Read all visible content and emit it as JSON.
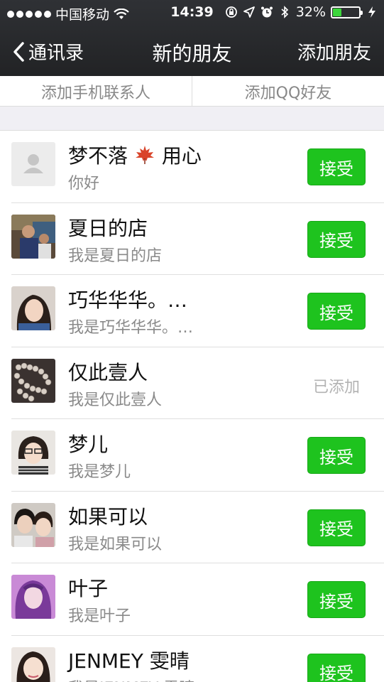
{
  "status": {
    "carrier": "中国移动",
    "time": "14:39",
    "battery_percent": "32%",
    "battery_level": 0.32
  },
  "nav": {
    "back_label": "通讯录",
    "title": "新的朋友",
    "right_label": "添加朋友"
  },
  "add_options": {
    "phone_contacts": "添加手机联系人",
    "qq_friends": "添加QQ好友"
  },
  "requests": [
    {
      "name_prefix": "梦不落",
      "name_suffix": "用心",
      "message": "你好",
      "status": "接受"
    },
    {
      "name": "夏日的店",
      "message": "我是夏日的店",
      "status": "接受"
    },
    {
      "name": "巧华华华。…",
      "message": "我是巧华华华。…",
      "status": "接受"
    },
    {
      "name": "仅此壹人",
      "message": "我是仅此壹人",
      "status": "已添加"
    },
    {
      "name": "梦儿",
      "message": "我是梦儿",
      "status": "接受"
    },
    {
      "name": "如果可以",
      "message": "我是如果可以",
      "status": "接受"
    },
    {
      "name": "叶子",
      "message": "我是叶子",
      "status": "接受"
    },
    {
      "name": "JENMEY  雯晴",
      "message": "我是JENMEY  雯晴",
      "status": "接受"
    }
  ],
  "colors": {
    "accept_green": "#1ec31e",
    "nav_bg": "#2a2b2e"
  }
}
